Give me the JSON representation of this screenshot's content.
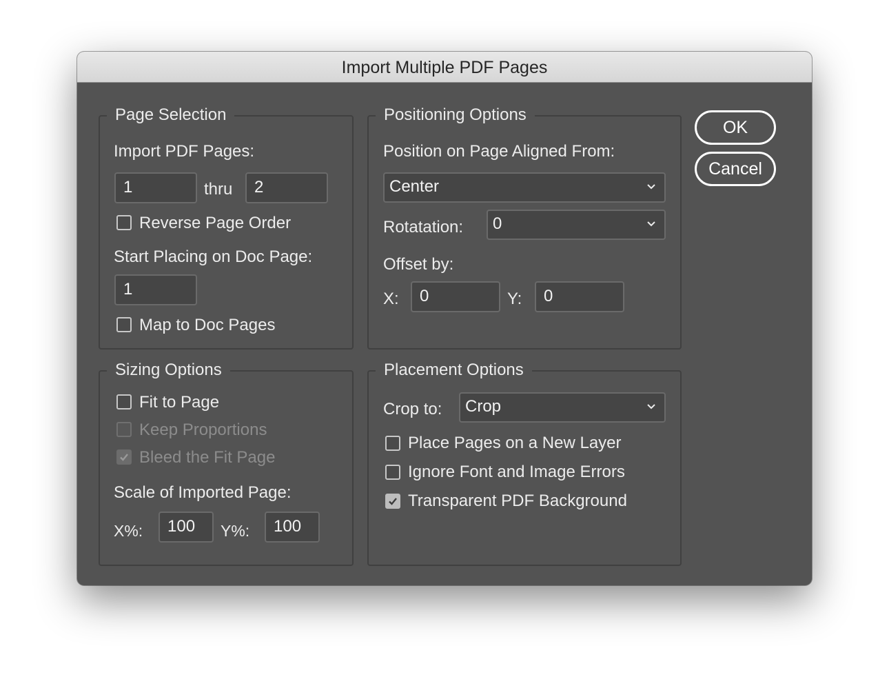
{
  "dialog": {
    "title": "Import Multiple PDF Pages"
  },
  "page_selection": {
    "legend": "Page Selection",
    "import_label": "Import PDF Pages:",
    "from_value": "1",
    "thru_label": "thru",
    "to_value": "2",
    "reverse_label": "Reverse Page Order",
    "reverse_checked": false,
    "start_label": "Start Placing on Doc Page:",
    "start_value": "1",
    "map_label": "Map to Doc Pages",
    "map_checked": false
  },
  "positioning": {
    "legend": "Positioning Options",
    "aligned_label": "Position on Page Aligned From:",
    "aligned_value": "Center",
    "rotation_label": "Rotatation:",
    "rotation_value": "0",
    "offset_label": "Offset by:",
    "x_label": "X:",
    "x_value": "0",
    "y_label": "Y:",
    "y_value": "0"
  },
  "sizing": {
    "legend": "Sizing Options",
    "fit_label": "Fit to Page",
    "fit_checked": false,
    "keep_label": "Keep Proportions",
    "keep_checked": false,
    "keep_disabled": true,
    "bleed_label": "Bleed the Fit Page",
    "bleed_checked": true,
    "bleed_disabled": true,
    "scale_label": "Scale of Imported Page:",
    "xp_label": "X%:",
    "xp_value": "100",
    "yp_label": "Y%:",
    "yp_value": "100"
  },
  "placement": {
    "legend": "Placement Options",
    "crop_label": "Crop to:",
    "crop_value": "Crop",
    "new_layer_label": "Place Pages on a New Layer",
    "new_layer_checked": false,
    "ignore_label": "Ignore Font and Image Errors",
    "ignore_checked": false,
    "transparent_label": "Transparent PDF Background",
    "transparent_checked": true
  },
  "buttons": {
    "ok": "OK",
    "cancel": "Cancel"
  },
  "icons": {
    "dropdown": "chevron-down-icon",
    "checkmark": "checkmark-icon"
  },
  "colors": {
    "dialog_bg": "#535353",
    "field_bg": "#454545",
    "text": "#ececec",
    "button_border": "#ffffff"
  }
}
